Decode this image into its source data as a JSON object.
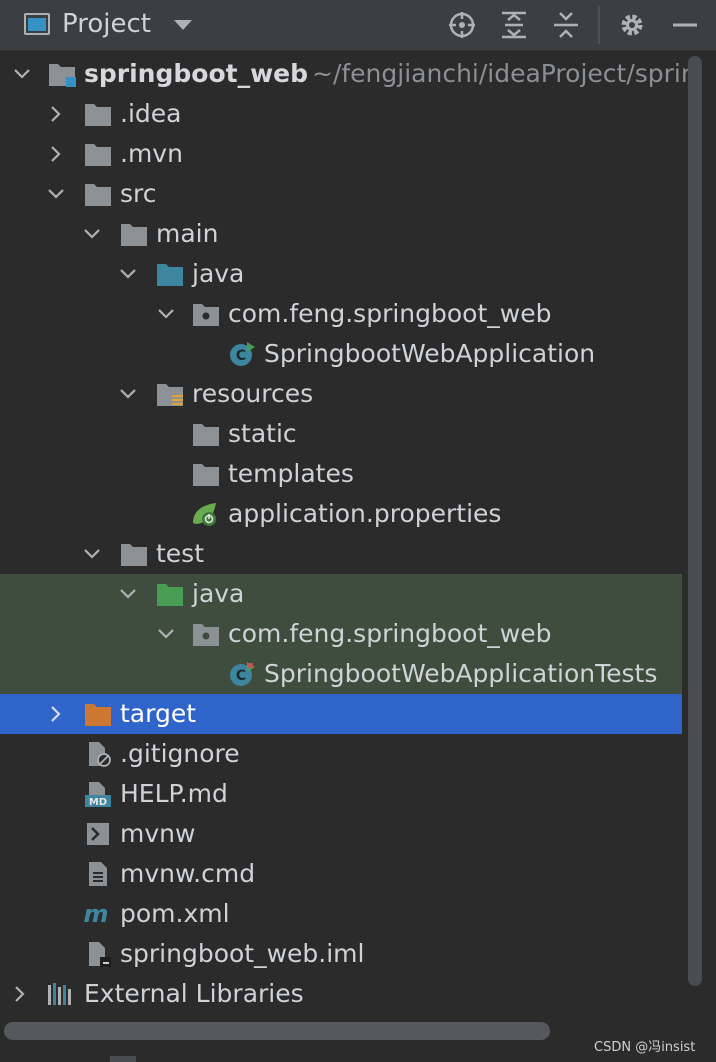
{
  "header": {
    "title": "Project",
    "icons": [
      "locate-icon",
      "expand-all-icon",
      "collapse-all-icon",
      "gear-icon",
      "minimize-icon"
    ]
  },
  "tree": {
    "root": {
      "name": "springboot_web",
      "path": "~/fengjianchi/ideaProject/sprir"
    },
    "items": {
      "idea": ".idea",
      "mvn": ".mvn",
      "src": "src",
      "main": "main",
      "main_java": "java",
      "main_package": "com.feng.springboot_web",
      "main_class": "SpringbootWebApplication",
      "resources": "resources",
      "static": "static",
      "templates": "templates",
      "app_props": "application.properties",
      "test": "test",
      "test_java": "java",
      "test_package": "com.feng.springboot_web",
      "test_class": "SpringbootWebApplicationTests",
      "target": "target",
      "gitignore": ".gitignore",
      "help": "HELP.md",
      "mvnw": "mvnw",
      "mvnw_cmd": "mvnw.cmd",
      "pom": "pom.xml",
      "iml": "springboot_web.iml",
      "external": "External Libraries"
    }
  },
  "colors": {
    "selected": "#2f65ca",
    "test_highlight": "#3e4d3e",
    "folder": "#8c9196",
    "source_folder": "#3e86a0",
    "test_folder": "#499c54",
    "excluded_folder": "#cc7832"
  },
  "watermark": "CSDN @冯insist"
}
